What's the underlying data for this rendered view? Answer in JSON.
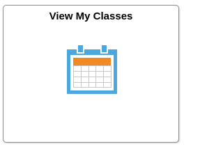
{
  "tile": {
    "title": "View My Classes",
    "icon": "calendar-icon"
  },
  "colors": {
    "calendar_frame": "#4aa8de",
    "calendar_header": "#f08a24",
    "calendar_grid": "#c8c8c8",
    "tile_border": "#8c8c8c"
  }
}
